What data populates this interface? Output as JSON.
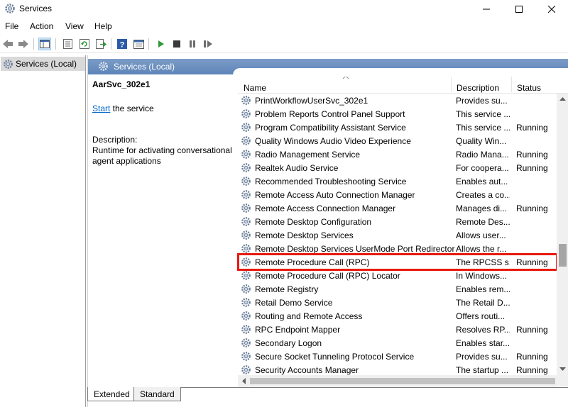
{
  "window": {
    "title": "Services"
  },
  "menu": [
    "File",
    "Action",
    "View",
    "Help"
  ],
  "tree": {
    "selected_label": "Services (Local)"
  },
  "header": {
    "title": "Services (Local)"
  },
  "details": {
    "service_name": "AarSvc_302e1",
    "start_link": "Start",
    "start_suffix": " the service",
    "description_label": "Description:",
    "description_text": "Runtime for activating conversational agent applications"
  },
  "columns": {
    "name": "Name",
    "description": "Description",
    "status": "Status"
  },
  "services": [
    {
      "name": "PrintWorkflowUserSvc_302e1",
      "description": "Provides su...",
      "status": ""
    },
    {
      "name": "Problem Reports Control Panel Support",
      "description": "This service ...",
      "status": ""
    },
    {
      "name": "Program Compatibility Assistant Service",
      "description": "This service ...",
      "status": "Running"
    },
    {
      "name": "Quality Windows Audio Video Experience",
      "description": "Quality Win...",
      "status": ""
    },
    {
      "name": "Radio Management Service",
      "description": "Radio Mana...",
      "status": "Running"
    },
    {
      "name": "Realtek Audio Service",
      "description": "For coopera...",
      "status": "Running"
    },
    {
      "name": "Recommended Troubleshooting Service",
      "description": "Enables aut...",
      "status": ""
    },
    {
      "name": "Remote Access Auto Connection Manager",
      "description": "Creates a co...",
      "status": ""
    },
    {
      "name": "Remote Access Connection Manager",
      "description": "Manages di...",
      "status": "Running"
    },
    {
      "name": "Remote Desktop Configuration",
      "description": "Remote Des...",
      "status": ""
    },
    {
      "name": "Remote Desktop Services",
      "description": "Allows user...",
      "status": ""
    },
    {
      "name": "Remote Desktop Services UserMode Port Redirector",
      "description": "Allows the r...",
      "status": ""
    },
    {
      "name": "Remote Procedure Call (RPC)",
      "description": "The RPCSS s...",
      "status": "Running"
    },
    {
      "name": "Remote Procedure Call (RPC) Locator",
      "description": "In Windows...",
      "status": ""
    },
    {
      "name": "Remote Registry",
      "description": "Enables rem...",
      "status": ""
    },
    {
      "name": "Retail Demo Service",
      "description": "The Retail D...",
      "status": ""
    },
    {
      "name": "Routing and Remote Access",
      "description": "Offers routi...",
      "status": ""
    },
    {
      "name": "RPC Endpoint Mapper",
      "description": "Resolves RP...",
      "status": "Running"
    },
    {
      "name": "Secondary Logon",
      "description": "Enables star...",
      "status": ""
    },
    {
      "name": "Secure Socket Tunneling Protocol Service",
      "description": "Provides su...",
      "status": "Running"
    },
    {
      "name": "Security Accounts Manager",
      "description": "The startup ...",
      "status": "Running"
    }
  ],
  "tabs": [
    "Extended",
    "Standard"
  ],
  "colors": {
    "highlight": "#e8190f",
    "header_bg": "#6a8fbf",
    "link": "#0066cc"
  },
  "icons": [
    "services-gear-icon",
    "back-arrow-icon",
    "forward-arrow-icon",
    "show-tree-icon",
    "properties-icon",
    "refresh-icon",
    "export-icon",
    "help-icon",
    "console-icon",
    "play-icon",
    "stop-icon",
    "pause-icon",
    "restart-icon"
  ]
}
